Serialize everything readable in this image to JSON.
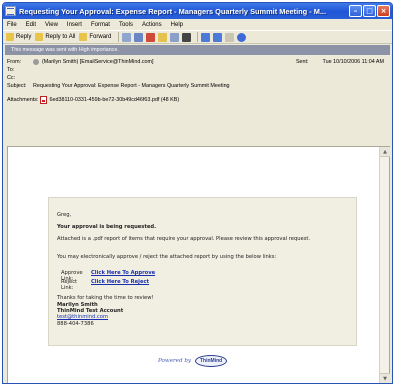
{
  "window": {
    "title": "Requesting Your Approval: Expense Report - Managers Quarterly Summit Meeting - M..."
  },
  "menu": [
    "File",
    "Edit",
    "View",
    "Insert",
    "Format",
    "Tools",
    "Actions",
    "Help"
  ],
  "toolbar": {
    "reply": "Reply",
    "reply_all": "Reply to All",
    "forward": "Forward"
  },
  "infobar": "This message was sent with High importance.",
  "header": {
    "from_label": "From:",
    "from_value": "(Marilyn Smith) [EmailService@ThinMind.com]",
    "to_label": "To:",
    "cc_label": "Cc:",
    "subject_label": "Subject:",
    "subject_value": "Requesting Your Approval: Expense Report - Managers Quarterly Summit Meeting",
    "sent_label": "Sent:",
    "sent_value": "Tue 10/10/2006 11:04 AM",
    "attachments_label": "Attachments:",
    "attachment_file": "6ed38110-0331-459b-be72-30b49cd46f63.pdf (48 KB)"
  },
  "email": {
    "greeting": "Greg,",
    "headline": "Your approval is being requested.",
    "para1": "Attached is a .pdf report of items that require your approval. Please review this approval request.",
    "para2": "You may electronically approve / reject the attached report by using the below links:",
    "approve_label": "Approve Link:",
    "approve_link": "Click Here To Approve",
    "reject_label": "Reject Link:",
    "reject_link": "Click Here To Reject",
    "thanks": "Thanks for taking the time to review!",
    "sig_name": "Marilyn Smith",
    "sig_account": "ThinMind Test Account",
    "sig_email": "test@thinmind.com",
    "sig_phone": "888-404-7386"
  },
  "footer": {
    "powered": "Powered by",
    "logo": "ThinMind"
  },
  "colors": {
    "titlebar": "#2a5fd8",
    "link": "#1a2fb0",
    "card_bg": "#f1efe2"
  }
}
